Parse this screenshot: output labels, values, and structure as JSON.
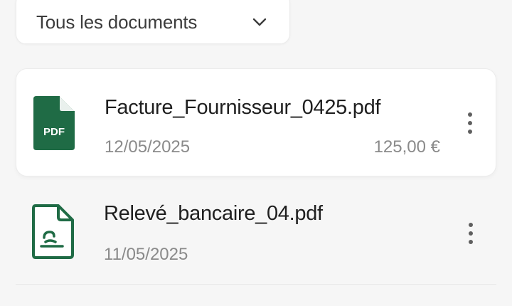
{
  "filter": {
    "label": "Tous les documents",
    "icon": "chevron-down-icon"
  },
  "colors": {
    "accent": "#1f6b45",
    "text_primary": "#1f1f1f",
    "text_secondary": "#8a8a8a"
  },
  "documents": [
    {
      "name": "Facture_Fournisseur_0425.pdf",
      "date": "12/05/2025",
      "amount": "125,00 €",
      "icon": "pdf-file-icon",
      "icon_badge": "PDF",
      "highlighted": true
    },
    {
      "name": "Relevé_bancaire_04.pdf",
      "date": "11/05/2025",
      "amount": "",
      "icon": "bank-statement-file-icon",
      "highlighted": false
    }
  ]
}
